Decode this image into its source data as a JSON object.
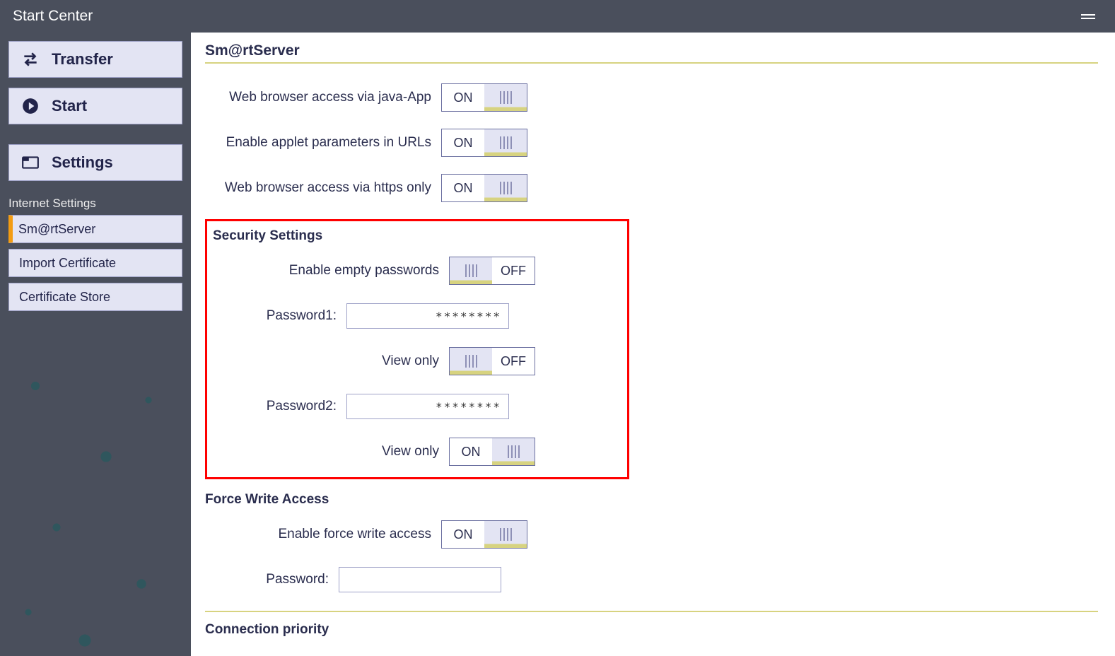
{
  "titlebar": {
    "title": "Start Center"
  },
  "sidebar": {
    "primary": [
      {
        "id": "transfer",
        "label": "Transfer"
      },
      {
        "id": "start",
        "label": "Start"
      },
      {
        "id": "settings",
        "label": "Settings"
      }
    ],
    "subhead": "Internet Settings",
    "subitems": [
      {
        "id": "smartserver",
        "label": "Sm@rtServer",
        "active": true
      },
      {
        "id": "importcert",
        "label": "Import Certificate"
      },
      {
        "id": "certstore",
        "label": "Certificate Store"
      }
    ]
  },
  "main": {
    "page_title": "Sm@rtServer",
    "section1": {
      "r1": {
        "label": "Web browser access via java-App",
        "state": "ON"
      },
      "r2": {
        "label": "Enable applet parameters in URLs",
        "state": "ON"
      },
      "r3": {
        "label": "Web browser access via https only",
        "state": "ON"
      }
    },
    "security": {
      "title": "Security Settings",
      "r1": {
        "label": "Enable empty passwords",
        "state": "OFF"
      },
      "pw1": {
        "label": "Password1:",
        "value": "********"
      },
      "r2": {
        "label": "View only",
        "state": "OFF"
      },
      "pw2": {
        "label": "Password2:",
        "value": "********"
      },
      "r3": {
        "label": "View only",
        "state": "ON"
      }
    },
    "force": {
      "title": "Force Write Access",
      "r1": {
        "label": "Enable force write access",
        "state": "ON"
      },
      "pw": {
        "label": "Password:",
        "value": ""
      }
    },
    "conn": {
      "title": "Connection priority"
    },
    "on_text": "ON",
    "off_text": "OFF"
  }
}
